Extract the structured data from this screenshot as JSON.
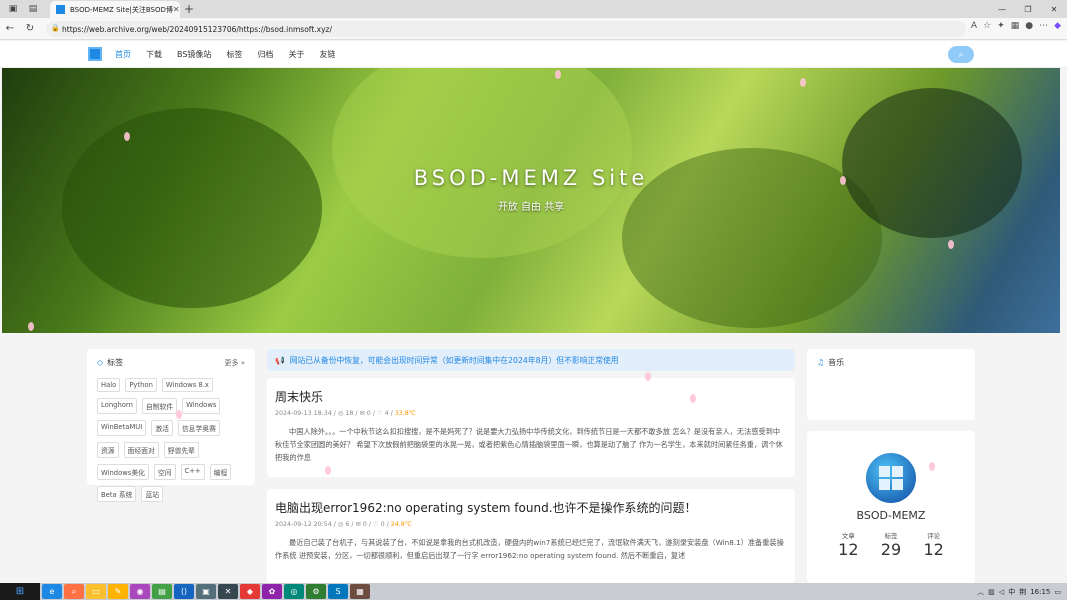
{
  "browser": {
    "tab_title": "BSOD-MEMZ Site|关注BSOD博",
    "close_glyph": "✕",
    "new_tab_glyph": "+",
    "url": "https://web.archive.org/web/20240915123706/https://bsod.inmsoft.xyz/"
  },
  "site": {
    "nav": [
      "首页",
      "下载",
      "BS镜像站",
      "标签",
      "归档",
      "关于",
      "友链"
    ],
    "active_nav": "首页",
    "hero_title": "BSOD-MEMZ Site",
    "hero_subtitle": "开放 自由 共享"
  },
  "tags_widget": {
    "title": "标签",
    "more": "更多 »",
    "tags": [
      "Halo",
      "Python",
      "Windows 8.x",
      "Longhorn",
      "自制软件",
      "Windows",
      "WinBetaMUI",
      "激活",
      "信息学奥赛",
      "资源",
      "面经面对",
      "野兽先辈",
      "Windows美化",
      "空间",
      "C++",
      "编程",
      "Beta 系统",
      "蓝站"
    ]
  },
  "notice": "网站已从备份中恢复，可能会出现时间异常（如更新时间集中在2024年8月）但不影响正常使用",
  "posts": [
    {
      "title": "周末快乐",
      "date": "2024-09-13 18:34",
      "views": "18",
      "comments": "0",
      "likes": "4",
      "temp": "33.8℃",
      "excerpt": "中国人除外。。。一个中秋节这么扣扣搜搜，是不是妈死了？说是要大力弘扬中华传统文化，到传统节日是一天都不敢多放 怎么？是没有亲人，无法感受到中秋佳节全家团圆的美好？ 希望下次放假前把脑袋里的水晃一晃，或者把紫色心情插脑袋里面一瞬，也算是动了脑了 作为一名学生，本来就时间紧任务重，调个休把我的作息"
    },
    {
      "title": "电脑出现error1962:no operating system found.也许不是操作系统的问题！",
      "date": "2024-09-12 20:54",
      "views": "6",
      "comments": "0",
      "likes": "0",
      "temp": "24.8℃",
      "excerpt": "最近自己装了台机子，与其说装了台，不如说是拿我的台式机改造，硬盘内的win7系统已经烂完了，流氓软件满天飞，遂刻录安装盘（Win8.1）准备重装操作系统 进预安装，分区，一切都很顺利，但重启后出现了一行字 error1962:no operating system found. 然后不断重启，复述"
    }
  ],
  "music_widget": {
    "title": "音乐"
  },
  "profile": {
    "name": "BSOD-MEMZ",
    "stats": [
      {
        "label": "文章",
        "value": "12"
      },
      {
        "label": "标签",
        "value": "29"
      },
      {
        "label": "评论",
        "value": "12"
      }
    ]
  },
  "taskbar": {
    "ime": "中",
    "ime2": "荆",
    "time": "16:15"
  },
  "colors": {
    "accent": "#1e88e5",
    "notice_bg": "#e3eefb"
  }
}
